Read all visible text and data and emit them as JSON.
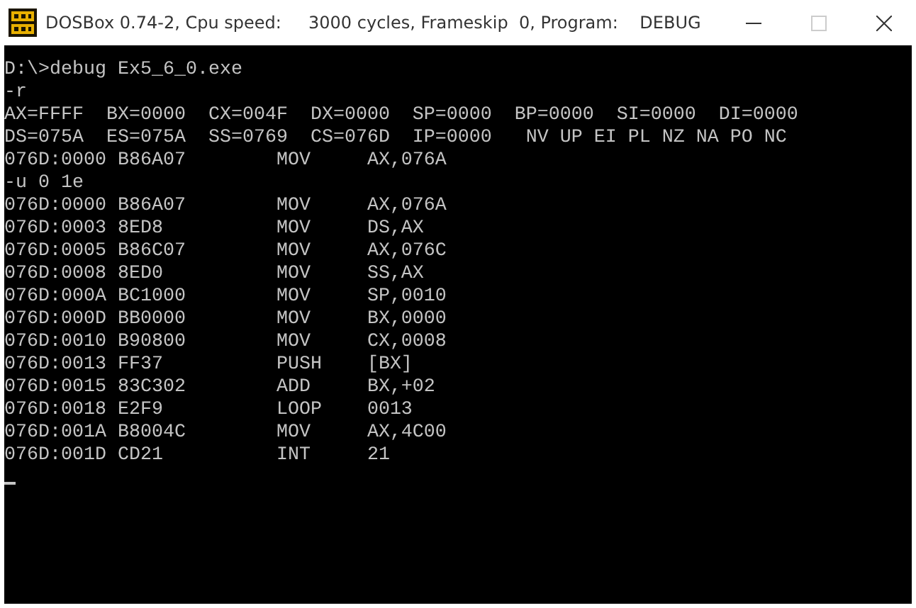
{
  "window": {
    "title": "DOSBox 0.74-2, Cpu speed:     3000 cycles, Frameskip  0, Program:    DEBUG",
    "controls": [
      {
        "kind": "minimize",
        "disabled": false
      },
      {
        "kind": "maximize",
        "disabled": true
      },
      {
        "kind": "close",
        "disabled": false
      }
    ]
  },
  "console": {
    "lines": [
      "D:\\>debug Ex5_6_0.exe",
      "-r",
      "AX=FFFF  BX=0000  CX=004F  DX=0000  SP=0000  BP=0000  SI=0000  DI=0000",
      "DS=075A  ES=075A  SS=0769  CS=076D  IP=0000   NV UP EI PL NZ NA PO NC",
      "076D:0000 B86A07        MOV     AX,076A",
      "-u 0 1e",
      "076D:0000 B86A07        MOV     AX,076A",
      "076D:0003 8ED8          MOV     DS,AX",
      "076D:0005 B86C07        MOV     AX,076C",
      "076D:0008 8ED0          MOV     SS,AX",
      "076D:000A BC1000        MOV     SP,0010",
      "076D:000D BB0000        MOV     BX,0000",
      "076D:0010 B90800        MOV     CX,0008",
      "076D:0013 FF37          PUSH    [BX]",
      "076D:0015 83C302        ADD     BX,+02",
      "076D:0018 E2F9          LOOP    0013",
      "076D:001A B8004C        MOV     AX,4C00",
      "076D:001D CD21          INT     21"
    ],
    "cursor": true
  }
}
